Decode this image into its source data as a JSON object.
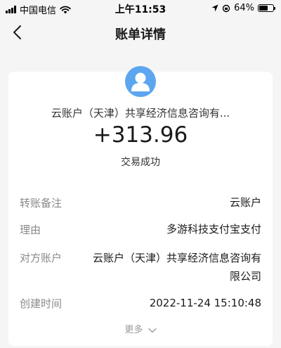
{
  "status_bar": {
    "carrier": "中国电信",
    "time": "上午11:53",
    "battery": "64%",
    "battery_level": 0.64
  },
  "nav": {
    "title": "账单详情"
  },
  "transaction": {
    "counterparty": "云账户（天津）共享经济信息咨询有...",
    "amount": "+313.96",
    "status": "交易成功"
  },
  "details": [
    {
      "label": "转账备注",
      "value": "云账户"
    },
    {
      "label": "理由",
      "value": "多游科技支付宝支付"
    },
    {
      "label": "对方账户",
      "value_line1": "云账户（天津）共享经济信息咨询有",
      "value_line2": "限公司"
    },
    {
      "label": "创建时间",
      "value": "2022-11-24 15:10:48"
    }
  ],
  "more_label": "更多",
  "colors": {
    "avatar": "#5ca6f0",
    "label_gray": "#8a8a8a"
  },
  "icons": [
    "signal-icon",
    "wifi-icon",
    "location-icon",
    "orientation-lock-icon",
    "battery-icon",
    "back-chevron-icon",
    "user-avatar-icon",
    "chevron-down-icon"
  ]
}
